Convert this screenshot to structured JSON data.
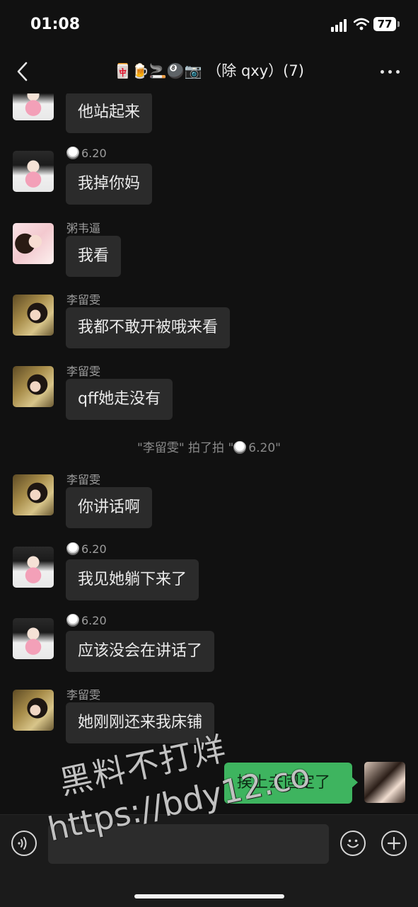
{
  "status_bar": {
    "time": "01:08",
    "battery": "77"
  },
  "header": {
    "title_emoji": "🀄🍺🚬🎱📷",
    "title_text": "（除 qxy）(7)"
  },
  "messages": [
    {
      "sender": "",
      "text": "他站起来",
      "avatar": "a"
    },
    {
      "sender": "6.20",
      "text": "我掉你妈",
      "avatar": "a"
    },
    {
      "sender": "粥韦逼",
      "text": "我看",
      "avatar": "b"
    },
    {
      "sender": "李留雯",
      "text": "我都不敢开被哦来看",
      "avatar": "c"
    },
    {
      "sender": "李留雯",
      "text": "qff她走没有",
      "avatar": "c"
    },
    {
      "sender": "李留雯",
      "text": "你讲话啊",
      "avatar": "c"
    },
    {
      "sender": "6.20",
      "text": "我见她躺下来了",
      "avatar": "a"
    },
    {
      "sender": "6.20",
      "text": "应该没会在讲话了",
      "avatar": "a"
    },
    {
      "sender": "李留雯",
      "text": "她刚刚还来我床铺",
      "avatar": "c"
    }
  ],
  "system_note": {
    "prefix": "\"李留雯\" 拍了拍 \"",
    "name": "6.20",
    "suffix": "\""
  },
  "my_message": {
    "text": "挨上去固定了"
  },
  "input": {
    "value": "",
    "placeholder": ""
  },
  "watermark": {
    "line1": "黑料不打烊",
    "line2": "https://bdy12.co"
  },
  "icons": {
    "back": "chevron-left-icon",
    "more": "more-dots-icon",
    "voice": "voice-icon",
    "emoji": "emoji-icon",
    "plus": "plus-icon"
  },
  "colors": {
    "background": "#111111",
    "bubble_other": "#2b2b2b",
    "bubble_me": "#3eb45f"
  }
}
